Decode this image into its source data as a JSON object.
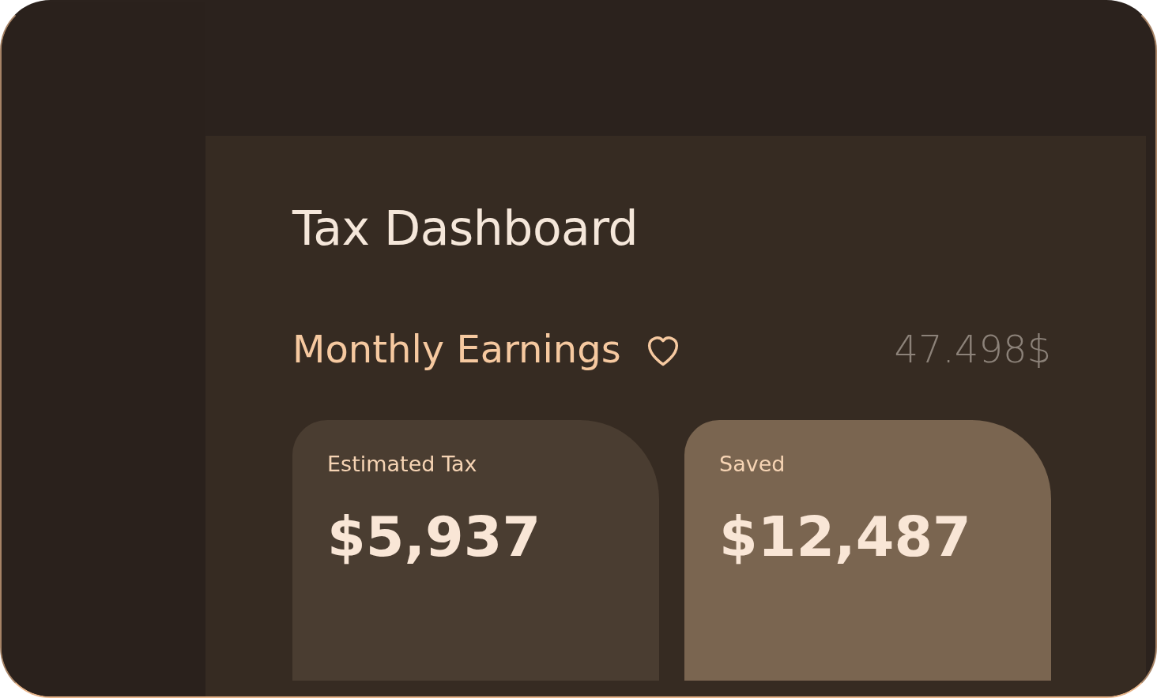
{
  "title": "Tax Dashboard",
  "earnings": {
    "title": "Monthly Earnings",
    "amount": "47.498$"
  },
  "cards": [
    {
      "label": "Estimated Tax",
      "value": "$5,937",
      "color": "#4a3d31"
    },
    {
      "label": "Saved",
      "value": "$12,487",
      "color": "#7a6550"
    }
  ]
}
